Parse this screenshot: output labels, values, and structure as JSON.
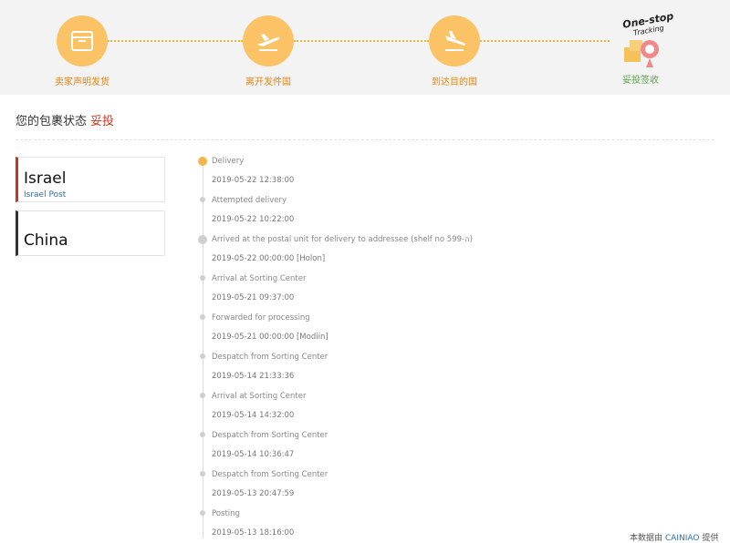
{
  "progress": {
    "steps": [
      {
        "label": "卖家声明发货",
        "icon": "package-icon"
      },
      {
        "label": "离开发件国",
        "icon": "plane-takeoff-icon"
      },
      {
        "label": "到达目的国",
        "icon": "plane-landing-icon"
      },
      {
        "label": "妥投签收",
        "icon": "one-stop-tracking-icon"
      }
    ],
    "badge_line1": "One-stop",
    "badge_line2": "Tracking",
    "colors": {
      "step": "#fbc365",
      "pending_label": "#e6850a",
      "done_label": "#5aa646"
    }
  },
  "status": {
    "label": "您的包裹状态",
    "value": "妥投"
  },
  "countries": [
    {
      "name": "Israel",
      "carrier": "Israel Post",
      "active": true
    },
    {
      "name": "China",
      "carrier": "",
      "active": false
    }
  ],
  "events": [
    {
      "desc": "Delivery",
      "time": "2019-05-22 12:38:00"
    },
    {
      "desc": "Attempted delivery",
      "time": "2019-05-22 10:22:00"
    },
    {
      "desc": "Arrived at the postal unit for delivery to addressee (shelf no 599-ה)",
      "time": "2019-05-22 00:00:00 [Holon]"
    },
    {
      "desc": "Arrival at Sorting Center",
      "time": "2019-05-21 09:37:00"
    },
    {
      "desc": "Forwarded for processing",
      "time": "2019-05-21 00:00:00 [Modiin]"
    },
    {
      "desc": "Despatch from Sorting Center",
      "time": "2019-05-14 21:33:36"
    },
    {
      "desc": "Arrival at Sorting Center",
      "time": "2019-05-14 14:32:00"
    },
    {
      "desc": "Despatch from Sorting Center",
      "time": "2019-05-14 10:36:47"
    },
    {
      "desc": "Despatch from Sorting Center",
      "time": "2019-05-13 20:47:59"
    },
    {
      "desc": "Posting",
      "time": "2019-05-13 18:16:00"
    }
  ],
  "credit": {
    "prefix": "本数据由",
    "link": "CAINIAO",
    "suffix": "提供"
  }
}
